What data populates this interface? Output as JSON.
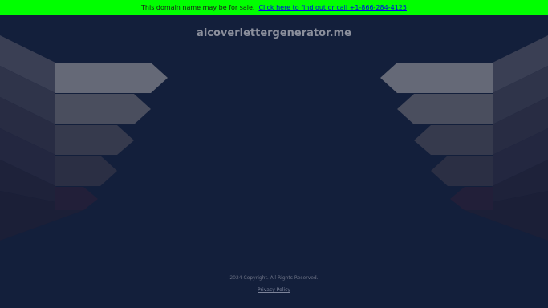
{
  "banner": {
    "text": "This domain name may be for sale.",
    "link_text": "Click here to find out or call +1-866-284-4125",
    "bg_color": "#00ff00"
  },
  "domain": {
    "name": "aicoverlettergenerator.me"
  },
  "footer": {
    "copyright": "2024 Copyright. All Rights Reserved.",
    "privacy_label": "Privacy Policy"
  },
  "colors": {
    "background": "#131f3b",
    "arrow_top": "#656977",
    "arrow_second": "#4a4e5e",
    "arrow_third": "#353a4d",
    "arrow_fourth": "#2a2f44"
  }
}
